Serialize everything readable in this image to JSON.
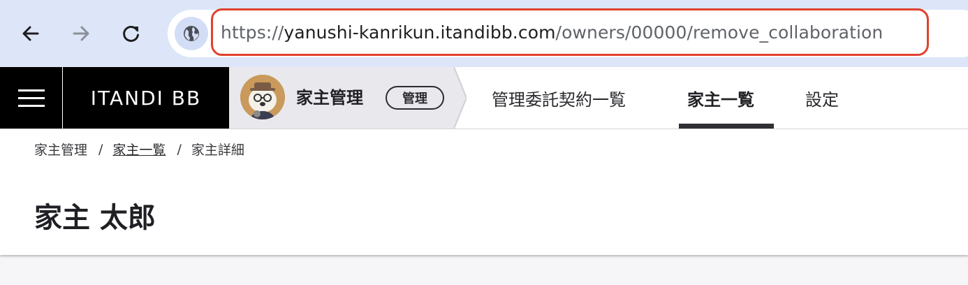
{
  "browser": {
    "url_scheme": "https://",
    "url_host": "yanushi-kanrikun.itandibb.com",
    "url_path": "/owners/00000/remove_collaboration",
    "back_icon": "arrow-left-icon",
    "forward_icon": "arrow-right-icon",
    "reload_icon": "reload-icon",
    "site_info_icon": "globe-icon",
    "highlight_color": "#e0412d"
  },
  "header": {
    "logo": "ITANDI BB",
    "product_name": "家主管理",
    "product_badge": "管理",
    "tabs": [
      {
        "label": "管理委託契約一覧",
        "active": false
      },
      {
        "label": "家主一覧",
        "active": true
      },
      {
        "label": "設定",
        "active": false
      }
    ]
  },
  "breadcrumb": {
    "items": [
      "家主管理",
      "家主一覧",
      "家主詳細"
    ],
    "separator": "/"
  },
  "page": {
    "title": "家主 太郎"
  }
}
